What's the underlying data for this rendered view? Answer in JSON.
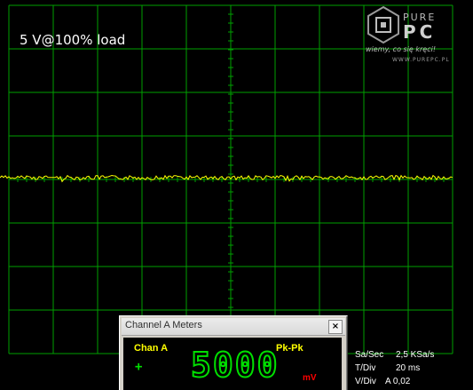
{
  "scope": {
    "load_label": "5 V@100% load",
    "grid_color": "#00a000",
    "trace_color": "#ffff00",
    "background_color": "#000000"
  },
  "logo": {
    "word1": "PURE",
    "word2": "PC",
    "tagline": "wiemy, co się kręci!",
    "url": "WWW.PUREPC.PL"
  },
  "meters": {
    "title": "Channel A Meters",
    "close_label": "×",
    "channel": "Chan A",
    "mode": "Pk-Pk",
    "sign": "+",
    "value": "5000",
    "unit": "mV",
    "digit_color": "#00e000",
    "label_color": "#ffff00",
    "unit_color": "#ff0000"
  },
  "status": {
    "sa_sec_label": "Sa/Sec",
    "sa_sec_value": "2,5 KSa/s",
    "t_div_label": "T/Div",
    "t_div_value": "20 ms",
    "v_div_label": "V/Div",
    "v_div_value": "A 0,02"
  }
}
